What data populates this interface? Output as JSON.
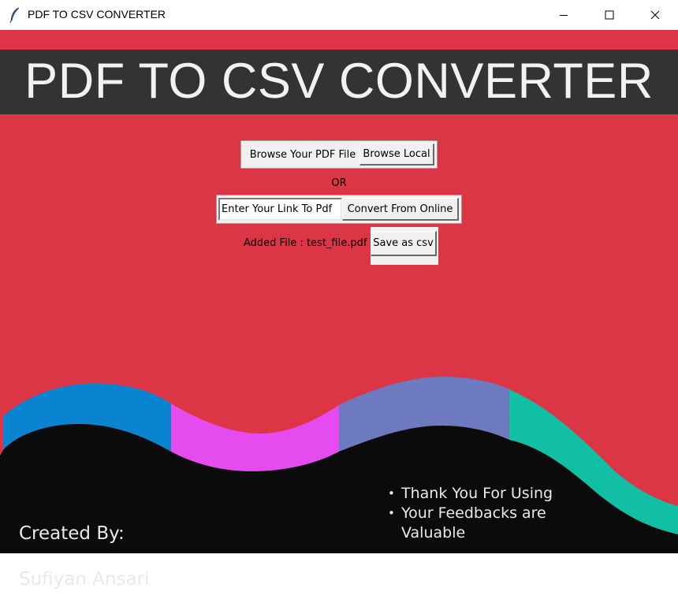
{
  "window": {
    "title": "PDF TO CSV CONVERTER",
    "icon": "feather-icon",
    "controls": [
      "minimize-icon",
      "maximize-icon",
      "close-icon"
    ]
  },
  "banner": {
    "title": "PDF TO CSV CONVERTER"
  },
  "browse": {
    "label": "Browse Your PDF File",
    "button": "Browse Local"
  },
  "or_text": "OR",
  "online": {
    "input_value": "Enter Your Link To Pdf",
    "button": "Convert From Online"
  },
  "file": {
    "added_label": "Added File : test_file.pdf",
    "save_button": "Save as csv"
  },
  "footer": {
    "credit_line1": "Created By:",
    "credit_line2": "Sufiyan Ansari",
    "notes": [
      "Thank You For Using",
      "Your Feedbacks are",
      "Valuable"
    ]
  },
  "colors": {
    "background": "#dc3545",
    "banner": "#333333",
    "wave_blue": "#0a84d1",
    "wave_magenta": "#e64bf0",
    "wave_purple": "#6e7ac0",
    "wave_teal": "#11c0a4",
    "wave_dark": "#0b0b0b"
  }
}
